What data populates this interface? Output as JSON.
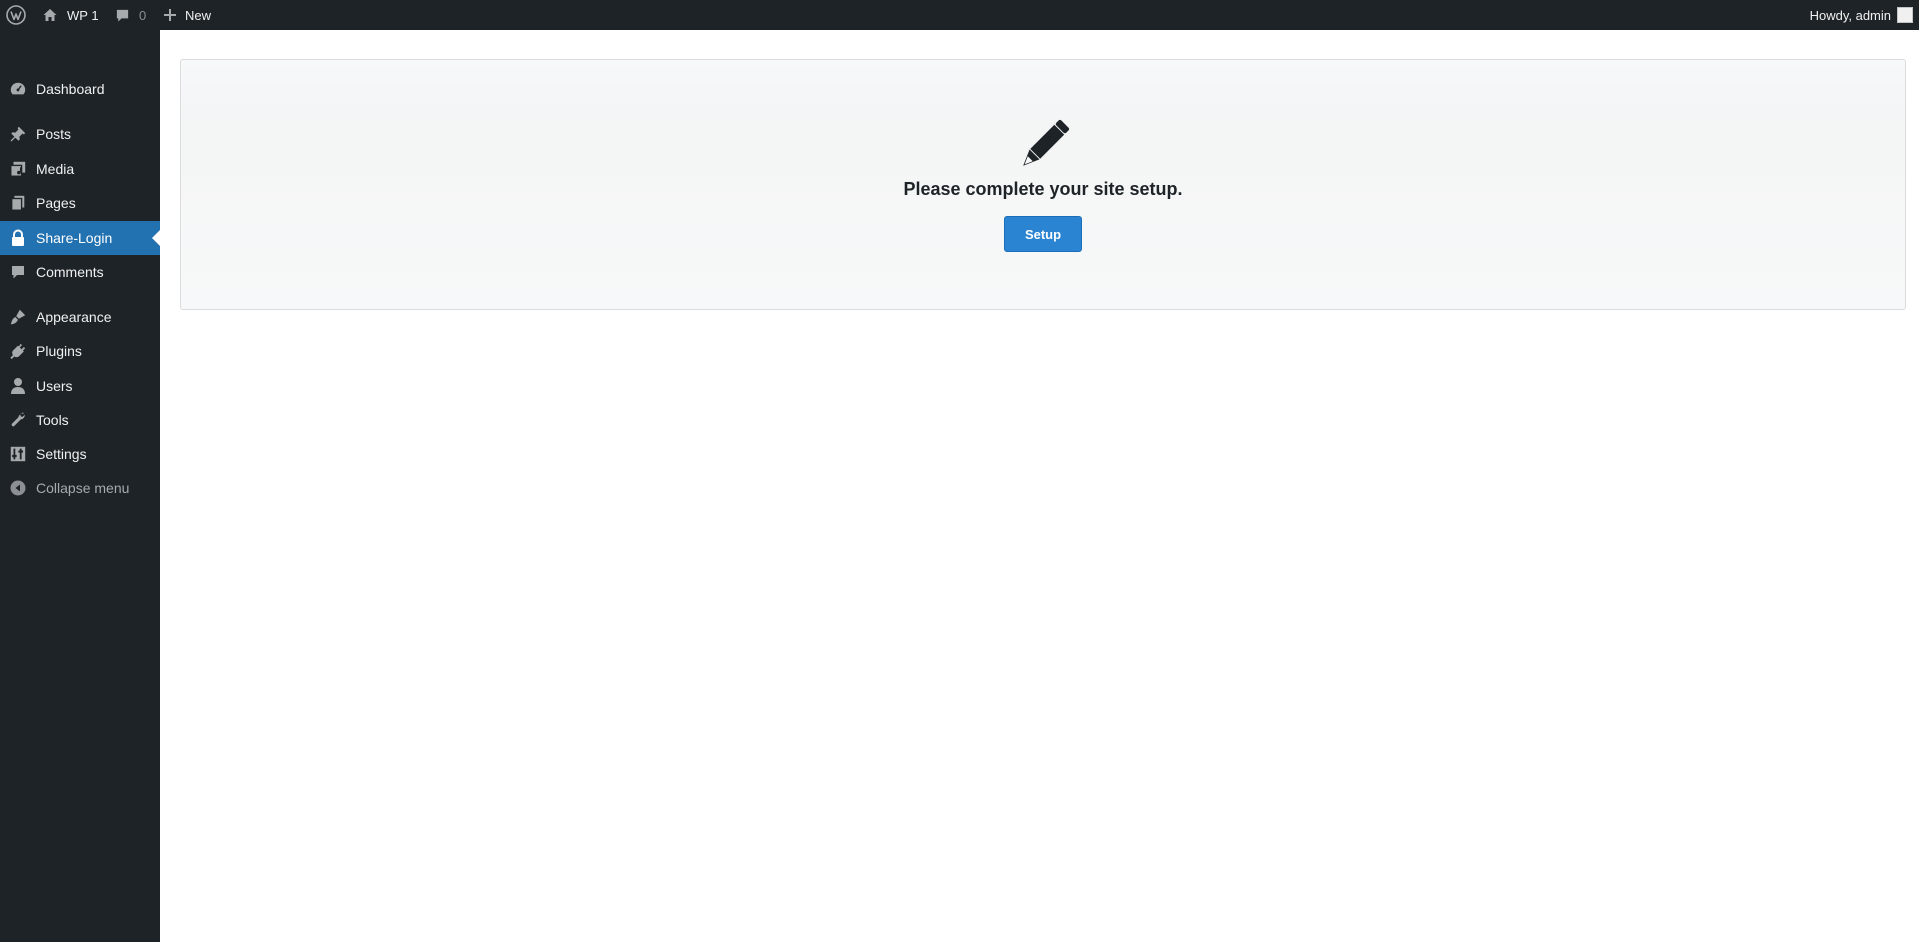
{
  "admin_bar": {
    "site_name": "WP 1",
    "comments_count": "0",
    "new_label": "New",
    "greeting": "Howdy, admin"
  },
  "sidebar": {
    "items": [
      {
        "label": "Dashboard",
        "icon": "dashboard-icon"
      },
      {
        "label": "Posts",
        "icon": "pin-icon"
      },
      {
        "label": "Media",
        "icon": "media-icon"
      },
      {
        "label": "Pages",
        "icon": "pages-icon"
      },
      {
        "label": "Share-Login",
        "icon": "lock-icon",
        "current": true
      },
      {
        "label": "Comments",
        "icon": "comment-icon"
      },
      {
        "label": "Appearance",
        "icon": "brush-icon"
      },
      {
        "label": "Plugins",
        "icon": "plug-icon"
      },
      {
        "label": "Users",
        "icon": "user-icon"
      },
      {
        "label": "Tools",
        "icon": "wrench-icon"
      },
      {
        "label": "Settings",
        "icon": "settings-icon"
      }
    ],
    "collapse_label": "Collapse menu"
  },
  "setup": {
    "icon": "pencil-icon",
    "message": "Please complete your site setup.",
    "button_label": "Setup"
  },
  "colors": {
    "admin_dark": "#1d2327",
    "accent": "#2271b1",
    "button": "#2a84d2"
  }
}
